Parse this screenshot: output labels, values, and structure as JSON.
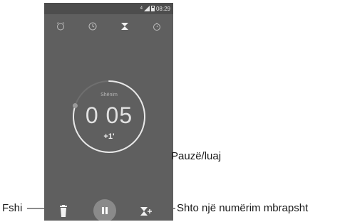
{
  "status": {
    "signal": "4",
    "time": "08:29"
  },
  "tabs": [
    {
      "icon": "alarm-icon"
    },
    {
      "icon": "clock-icon"
    },
    {
      "icon": "hourglass-icon",
      "active": true
    },
    {
      "icon": "stopwatch-icon"
    }
  ],
  "timer": {
    "label": "Shënim",
    "time": "0 05",
    "add_minute": "+1'",
    "progress": 0.8
  },
  "buttons": {
    "delete_icon": "trash-icon",
    "pause_icon": "pause-icon",
    "add_timer_icon": "add-hourglass-icon"
  },
  "callouts": {
    "pause": "Pauzë/luaj",
    "delete": "Fshi",
    "add_timer": "Shto një numërim mbrapsht"
  },
  "colors": {
    "screen": "#5f5f5f",
    "ring": "#e8e8e8",
    "ring_track": "#6f6f6f",
    "dot": "#9a9a9a"
  }
}
